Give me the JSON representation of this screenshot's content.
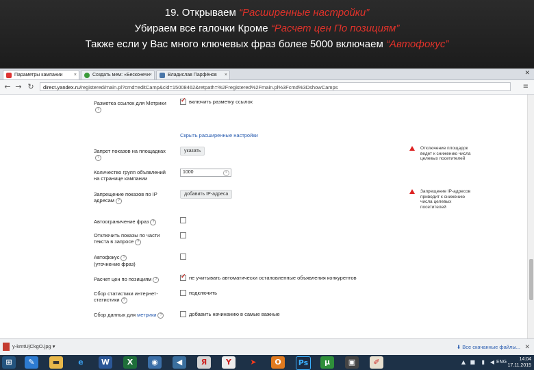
{
  "slide": {
    "line1": "19. Открываем ",
    "line1_accent": "“Расширенные настройки”",
    "line2": "Убираем все галочки Кроме ",
    "line2_accent": "“Расчет цен По позициям”",
    "line3": "Также если у Вас много ключевых фраз более 5000 включаем ",
    "line3_accent": "“Автофокус”"
  },
  "browser": {
    "tabs": [
      {
        "label": "Параметры кампании",
        "color": "#d33"
      },
      {
        "label": "Создать мем: «Бесконечн",
        "color": "#3a9a3a"
      },
      {
        "label": "Владислав Парфёнов",
        "color": "#4a76a8"
      }
    ],
    "url_domain": "direct.yandex.ru",
    "url_rest": "/registered/main.pl?cmd=editCamp&cid=15008462&retpath=%2Fregistered%2Fmain.pl%3Fcmd%3DshowCamps"
  },
  "form": {
    "metrika_label": "Разметка ссылок для Метрики",
    "metrika_option": "включить разметку ссылок",
    "show_settings_link": "Скрыть расширенные настройки",
    "restrict_sites_label": "Запрет показов на площадках",
    "restrict_sites_button": "указать",
    "restrict_sites_warning": "Отключение площадок ведет к снижению числа целевых посетителей",
    "competitors_label": "Количество групп объявлений на странице кампании",
    "competitors_value": "1000",
    "ip_label": "Запрещение показов по IP адресам",
    "ip_button": "добавить IP-адреса",
    "ip_warning": "Запрещение IP-адресов приводит к снижению числа целевых посетителей",
    "autobroad_label": "Автоограничение фраз",
    "stop_label": "Отключить показы по части текста в запросе",
    "autofocus_label": "Автофокус",
    "autofocus_sub": "(уточнение фраз)",
    "price_label": "Расчет цен по позициям",
    "price_option": "не учитывать автоматически остановленные объявления конкурентов",
    "stats_label": "Сбор статистики интернет-статистики",
    "stats_option": "подключить",
    "similar_label": "Сбор данных для",
    "similar_link": "метрики",
    "similar_option": "добавить начинанию в самые важные"
  },
  "downloads": {
    "file": "y-kmtUjCkgO.jpg",
    "show_all": "Все скачанные файлы..."
  },
  "taskbar": {
    "time": "14:04",
    "date": "17.11.2015",
    "lang": "ENG"
  }
}
